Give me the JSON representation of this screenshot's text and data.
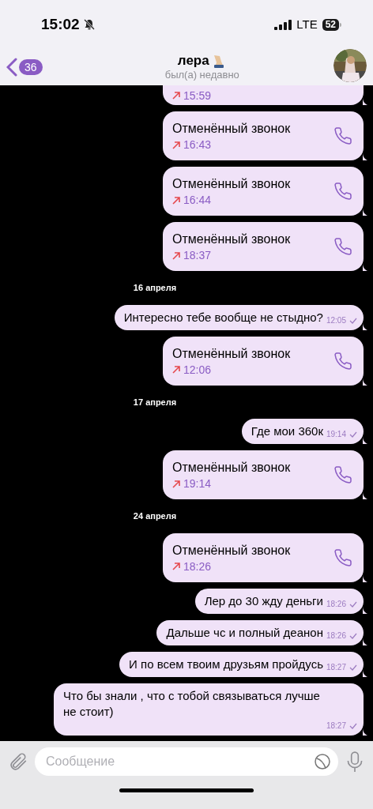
{
  "status_bar": {
    "time": "15:02",
    "network": "LTE",
    "battery": "52",
    "muted": true
  },
  "header": {
    "back_count": "36",
    "name": "лера",
    "status": "был(а) недавно"
  },
  "messages": [
    {
      "kind": "call",
      "time": "15:59"
    },
    {
      "kind": "call",
      "title": "Отменённый звонок",
      "time": "16:43"
    },
    {
      "kind": "call",
      "title": "Отменённый звонок",
      "time": "16:44"
    },
    {
      "kind": "call",
      "title": "Отменённый звонок",
      "time": "18:37"
    },
    {
      "kind": "date",
      "text": "16 апреля"
    },
    {
      "kind": "text",
      "text": "Интересно тебе вообще не стыдно?",
      "time": "12:05",
      "read": false
    },
    {
      "kind": "call",
      "title": "Отменённый звонок",
      "time": "12:06"
    },
    {
      "kind": "date",
      "text": "17 апреля"
    },
    {
      "kind": "text",
      "text": "Где мои 360к",
      "time": "19:14",
      "read": false
    },
    {
      "kind": "call",
      "title": "Отменённый звонок",
      "time": "19:14"
    },
    {
      "kind": "date",
      "text": "24 апреля"
    },
    {
      "kind": "call",
      "title": "Отменённый звонок",
      "time": "18:26"
    },
    {
      "kind": "text",
      "text": "Лер до 30 жду деньги",
      "time": "18:26",
      "read": false
    },
    {
      "kind": "text",
      "text": "Дальше чс и полный деанон",
      "time": "18:26",
      "read": false
    },
    {
      "kind": "text",
      "text": "И по всем твоим друзьям пройдусь",
      "time": "18:27",
      "read": false
    },
    {
      "kind": "text",
      "text": "Что бы знали , что с тобой связываться лучше не стоит)",
      "time": "18:27",
      "read": false
    }
  ],
  "composer": {
    "placeholder": "Сообщение"
  }
}
